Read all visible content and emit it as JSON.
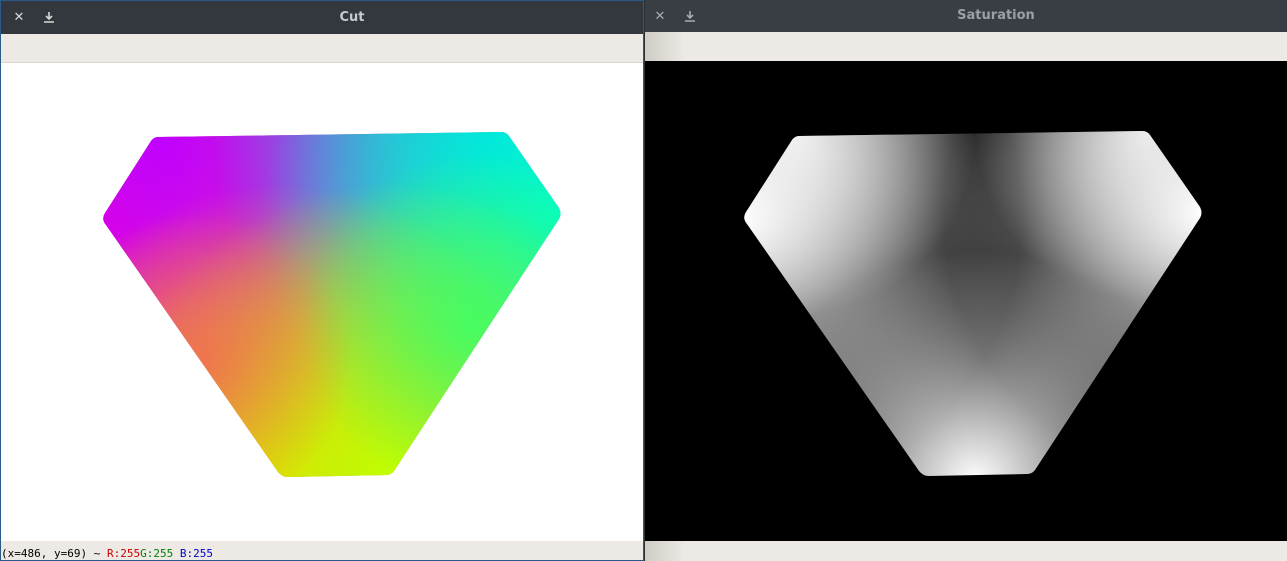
{
  "windows": [
    {
      "title": "Cut",
      "close_icon": "close-icon",
      "save_icon": "download-icon",
      "status": {
        "coords": "(x=486, y=69) ~",
        "r": "R:255",
        "g": "G:255",
        "b": "B:255"
      }
    },
    {
      "title": "Saturation",
      "close_icon": "close-icon",
      "save_icon": "download-icon"
    }
  ],
  "colors": {
    "titlebar": "#33383e",
    "toolbar": "#edeae5",
    "r_text": "#cc0000",
    "g_text": "#008000",
    "b_text": "#0000cc"
  }
}
